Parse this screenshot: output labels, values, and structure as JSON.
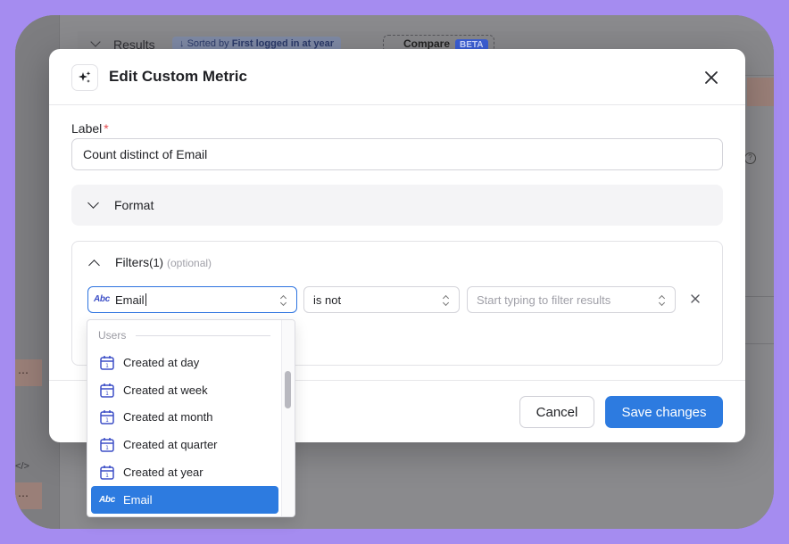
{
  "background_app": {
    "section_title": "Results",
    "sort_prefix": "Sorted by",
    "sort_field": "First logged in at year",
    "compare_label": "Compare",
    "beta_badge": "BETA",
    "sidebar_tag_1": "⋯",
    "sidebar_tag_2": "⋯",
    "code_icon": "</>"
  },
  "modal": {
    "title": "Edit Custom Metric",
    "title_icon": "sparkles-icon",
    "close_icon": "close-icon",
    "label_field": {
      "label": "Label",
      "required_mark": "*",
      "value": "Count distinct of Email"
    },
    "format_section": {
      "label": "Format",
      "expanded": false
    },
    "filters_section": {
      "label": "Filters",
      "count": "(1)",
      "optional": "(optional)",
      "expanded": true,
      "filter": {
        "field_value": "Email",
        "field_type_icon": "Abc",
        "operator": "is not",
        "value_placeholder": "Start typing to filter results"
      }
    },
    "footer": {
      "cancel_label": "Cancel",
      "save_label": "Save changes"
    },
    "colors": {
      "primary": "#2d7be0",
      "required": "#e5484d",
      "icon_blue": "#3d4fc7"
    }
  },
  "dropdown": {
    "group_label": "Users",
    "items": [
      {
        "label": "Created at day",
        "icon": "calendar-icon",
        "selected": false
      },
      {
        "label": "Created at week",
        "icon": "calendar-icon",
        "selected": false
      },
      {
        "label": "Created at month",
        "icon": "calendar-icon",
        "selected": false
      },
      {
        "label": "Created at quarter",
        "icon": "calendar-icon",
        "selected": false
      },
      {
        "label": "Created at year",
        "icon": "calendar-icon",
        "selected": false
      },
      {
        "label": "Email",
        "icon": "Abc",
        "selected": true
      }
    ]
  }
}
